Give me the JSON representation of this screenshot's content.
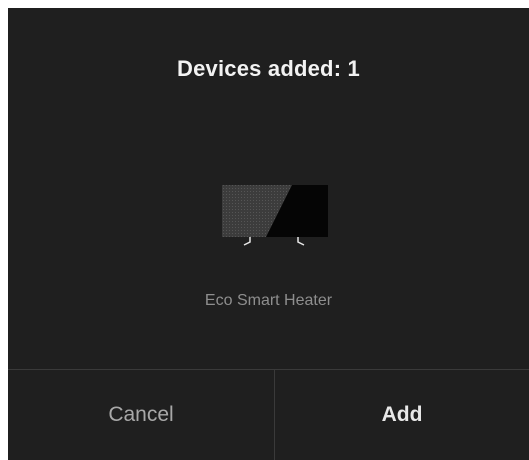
{
  "dialog": {
    "title": "Devices added: 1",
    "device": {
      "name": "Eco Smart Heater",
      "icon": "heater-icon"
    },
    "buttons": {
      "cancel_label": "Cancel",
      "add_label": "Add"
    }
  },
  "colors": {
    "dialog_background": "#1f1f1f",
    "divider": "#3a3a3a",
    "title_text": "#f2f2f2",
    "secondary_text": "#8e8e8e"
  }
}
